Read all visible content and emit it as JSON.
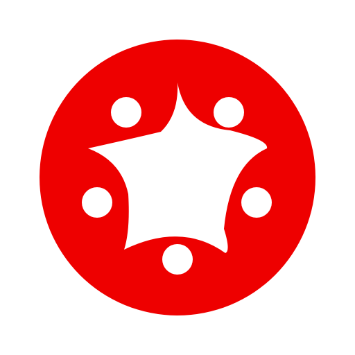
{
  "logo": {
    "icon": "red-circle-star-with-five-dots",
    "colors": {
      "background": "#ffffff",
      "disc": "#ee0000",
      "foreground": "#ffffff"
    }
  }
}
